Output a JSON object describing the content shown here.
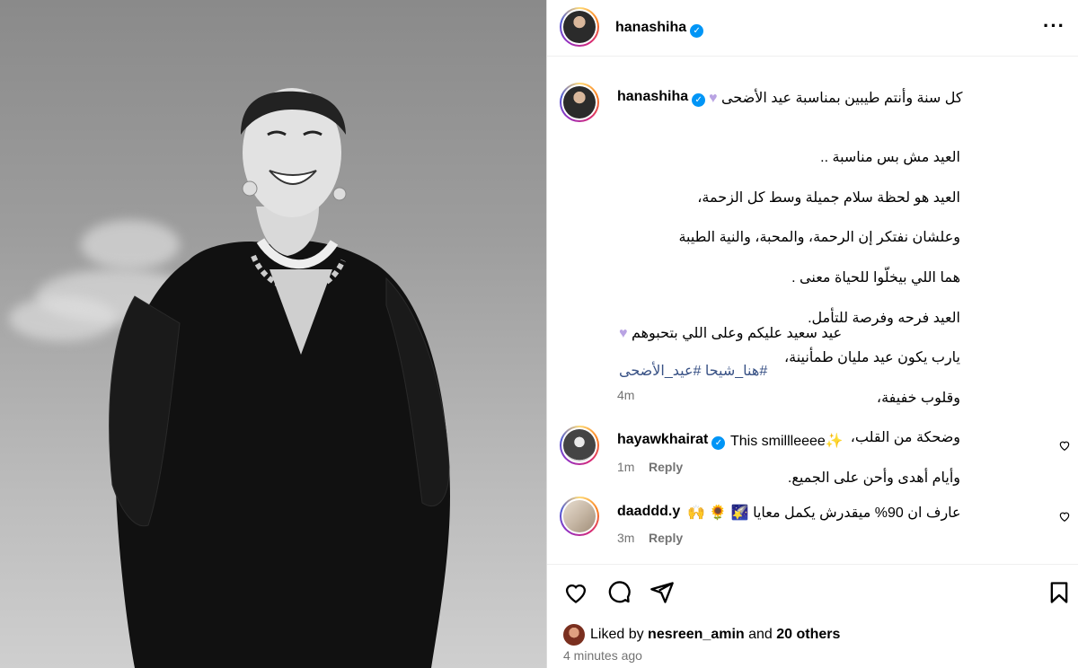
{
  "post": {
    "username": "hanashiha",
    "caption_first": "كل سنة وأنتم طيبين بمناسبة عيد الأضحى",
    "caption_lines": [
      "العيد مش بس مناسبة ..",
      "العيد هو لحظة سلام جميلة وسط كل الزحمة،",
      "وعلشان نفتكر إن الرحمة، والمحبة، والنية الطيبة",
      "هما اللي بيخلّوا للحياة معنى .",
      "العيد فرحه وفرصة للتأمل.",
      "يارب يكون عيد مليان طمأنينة،",
      "وقلوب خفيفة،",
      "وضحكة من القلب،",
      "وأيام أهدى وأحن على الجميع."
    ],
    "caption_closing": "عيد سعيد عليكم وعلى اللي بتحبوهم",
    "hashtags": "#هنا_شيحا #عيد_الأضحى",
    "time": "4m"
  },
  "comments": [
    {
      "username": "hayawkhairat",
      "text": "This smillleeee✨",
      "time": "1m",
      "reply": "Reply"
    },
    {
      "username": "daaddd.y",
      "text": "عارف ان 90% ميقدرش يكمل معايا 🌠 🌻 🙌",
      "time": "3m",
      "reply": "Reply"
    }
  ],
  "likes": {
    "prefix": "Liked by",
    "user": "nesreen_amin",
    "middle": "and",
    "others": "20 others"
  },
  "posted_ago": "4 minutes ago",
  "icons": {
    "more": "more-options-icon",
    "heart": "heart-icon",
    "comment": "comment-icon",
    "share": "share-icon",
    "save": "bookmark-icon",
    "verified": "verified-badge-icon"
  },
  "colors": {
    "verified": "#0095f6",
    "hashtag": "#385185",
    "muted": "#737373",
    "divider": "#dbdbdb"
  }
}
